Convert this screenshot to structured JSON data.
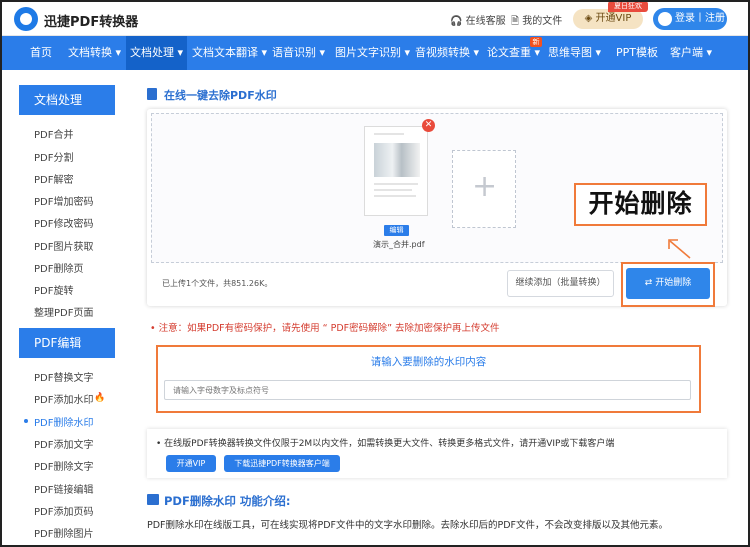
{
  "header": {
    "brand": "迅捷PDF转换器",
    "links": [
      {
        "label": "在线客服",
        "icon": "headset-icon"
      },
      {
        "label": "我的文件",
        "icon": "file-icon"
      }
    ],
    "vip_label": "开通VIP",
    "vip_badge": "夏日狂欢",
    "login_label": "登录丨注册",
    "new_badge": "新"
  },
  "nav": {
    "items": [
      "首页",
      "文档转换 ▾",
      "文档处理 ▾",
      "文档文本翻译 ▾",
      "语音识别 ▾",
      "图片文字识别 ▾",
      "音视频转换 ▾",
      "论文查重 ▾",
      "思维导图 ▾",
      "PPT模板",
      "客户端 ▾"
    ],
    "active_index": 2
  },
  "sidebar": {
    "sections": [
      {
        "title": "文档处理",
        "items": [
          "PDF合并",
          "PDF分割",
          "PDF解密",
          "PDF增加密码",
          "PDF修改密码",
          "PDF图片获取",
          "PDF删除页",
          "PDF旋转",
          "整理PDF页面"
        ]
      },
      {
        "title": "PDF编辑",
        "items": [
          "PDF替换文字",
          "PDF添加水印",
          "PDF删除水印",
          "PDF添加文字",
          "PDF删除文字",
          "PDF链接编辑",
          "PDF添加页码",
          "PDF删除图片"
        ]
      }
    ],
    "active_item": "PDF删除水印"
  },
  "main": {
    "section_title": "在线一键去除PDF水印",
    "file": {
      "edit_label": "编辑",
      "name": "演示_合并.pdf"
    },
    "callout": "开始删除",
    "upload_info": "已上传1个文件，共851.26K。",
    "continue_label": "继续添加（批量转换）",
    "start_label": "开始删除",
    "notice": "•  注意：如果PDF有密码保护，请先使用  “ PDF密码解除”  去除加密保护再上传文件",
    "watermark_title": "请输入要删除的水印内容",
    "watermark_placeholder": "请输入字母数字及标点符号",
    "info_text": "•  在线版PDF转换器转换文件仅限于2M以内文件，如需转换更大文件、转换更多格式文件，请开通VIP或下载客户端",
    "info_vip_btn": "开通VIP",
    "info_download_btn": "下载迅捷PDF转换器客户端",
    "intro_title": "PDF删除水印 功能介绍:",
    "intro_text": "PDF删除水印在线版工具，可在线实现将PDF文件中的文字水印删除。去除水印后的PDF文件，不会改变排版以及其他元素。"
  },
  "colors": {
    "primary": "#2b7de9",
    "highlight": "#f07a3a",
    "danger": "#d43c2f"
  }
}
